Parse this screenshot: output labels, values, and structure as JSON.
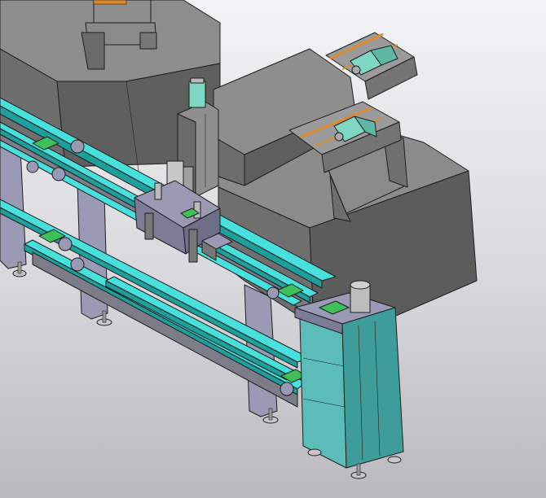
{
  "scene": {
    "background_top": "#f4f4f6",
    "background_bottom": "#b9b9bf",
    "colors": {
      "housing_top": "#8c8c8c",
      "housing_left": "#6f6f6f",
      "housing_right": "#5c5c5c",
      "frame": "#9a9ab4",
      "frame_dark": "#7c7c96",
      "rail": "#48e0dc",
      "rail_dark": "#1f9f9c",
      "motor": "#7fd6c2",
      "cabinet_front": "#5cbcba",
      "cabinet_side": "#3e9c9a",
      "pcb": "#3fbf5a",
      "guide": "#e08a2a"
    }
  }
}
